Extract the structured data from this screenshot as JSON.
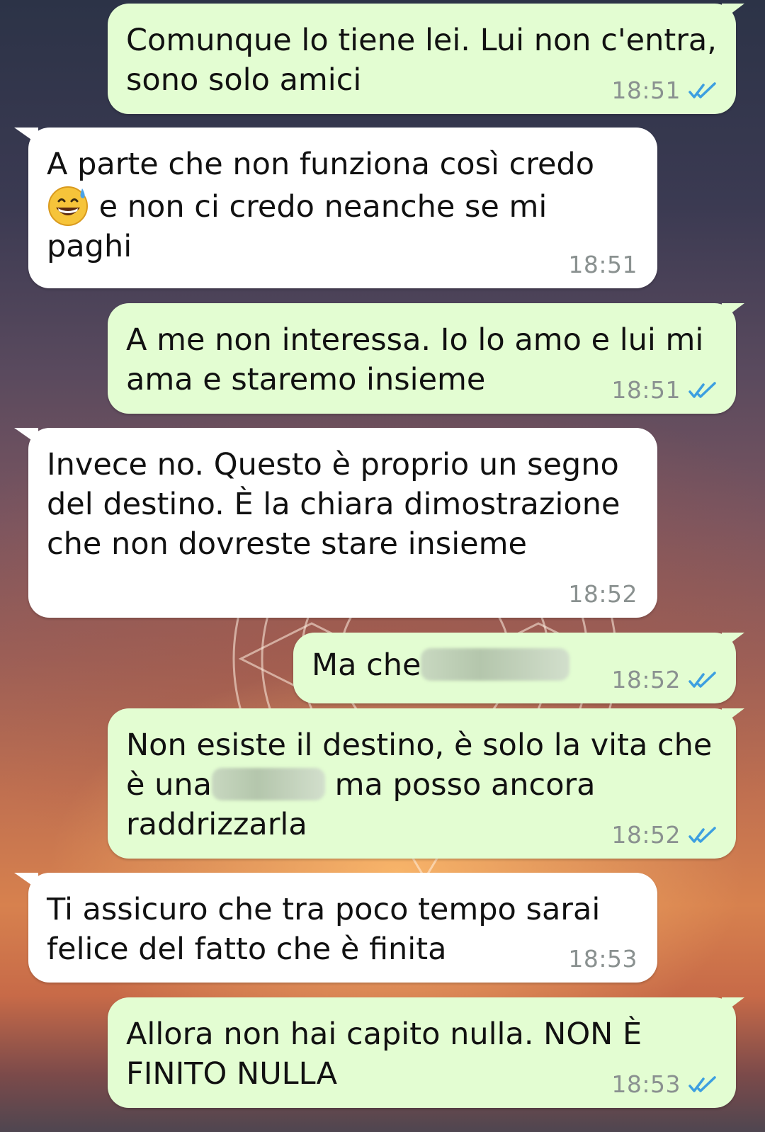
{
  "messages": [
    {
      "dir": "out",
      "text": "Comunque lo tiene lei. Lui non c'entra, sono solo amici",
      "time": "18:51",
      "read": true
    },
    {
      "dir": "in",
      "text_before": "A parte che non funziona così credo",
      "emoji": "grinning-face-with-sweat",
      "text_after": " e non ci credo neanche se mi paghi",
      "time": "18:51"
    },
    {
      "dir": "out",
      "text": "A me non interessa. Io lo amo e lui mi ama e staremo insieme",
      "time": "18:51",
      "read": true
    },
    {
      "dir": "in",
      "text": "Invece no. Questo è proprio un segno del destino. È la chiara dimostrazione che non dovreste stare insieme",
      "time": "18:52"
    },
    {
      "dir": "out",
      "text": "Ma che",
      "redacted": true,
      "time": "18:52",
      "read": true
    },
    {
      "dir": "out",
      "text_before": "Non esiste il destino, è solo la vita che è una",
      "redacted": true,
      "text_after": " ma posso ancora raddrizzarla",
      "time": "18:52",
      "read": true
    },
    {
      "dir": "in",
      "text": "Ti assicuro che tra poco tempo sarai felice del fatto che è finita",
      "time": "18:53"
    },
    {
      "dir": "out",
      "text": "Allora non hai capito nulla. NON È FINITO NULLA",
      "time": "18:53",
      "read": true
    }
  ],
  "colors": {
    "outgoing_bubble": "#e3fdd2",
    "incoming_bubble": "#ffffff",
    "read_ticks": "#3d9fe0",
    "timestamp": "#8a9190"
  },
  "icons": {
    "read_receipt": "double-check-icon"
  }
}
